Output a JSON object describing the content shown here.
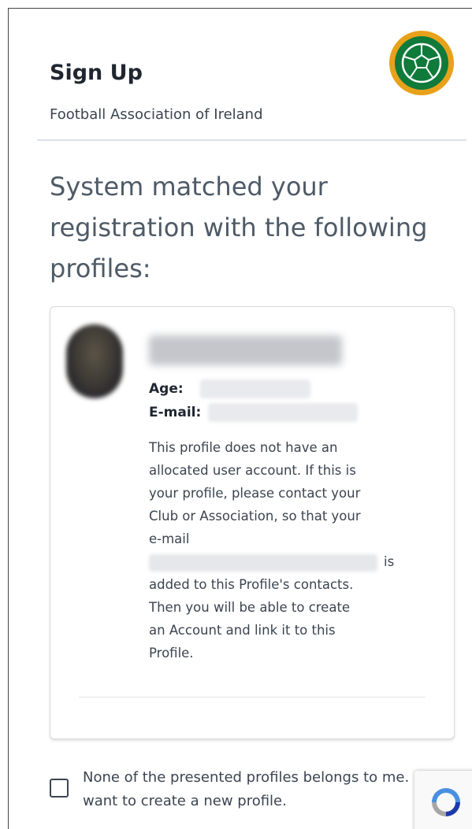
{
  "header": {
    "title": "Sign Up",
    "subtitle": "Football Association of Ireland",
    "logo_icon": "fai-crest-icon"
  },
  "heading": "System matched your registration with the following profiles:",
  "profile_card": {
    "age_label": "Age:",
    "email_label": "E-mail:",
    "description_lines": [
      "This profile does not have an",
      "allocated user account. If this is",
      "your profile, please contact your",
      "Club or Association, so that your",
      "e-mail",
      "is",
      "added to this Profile's contacts.",
      "Then you will be able to create",
      "an Account and link it to this",
      "Profile."
    ]
  },
  "checkbox": {
    "label": "None of the presented profiles belongs to me. I want to create a new profile."
  },
  "recaptcha_icon": "recaptcha-icon",
  "colors": {
    "logo_gold": "#e8a11b",
    "logo_green": "#0f7a3a",
    "text_dark": "#1f2630",
    "heading_gray": "#4e5a66"
  }
}
